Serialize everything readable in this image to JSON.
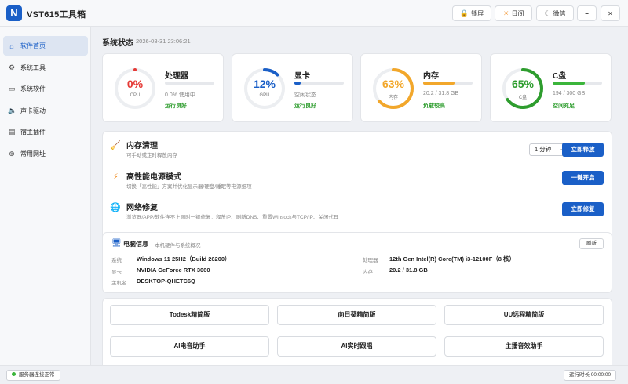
{
  "app": {
    "logo": "N",
    "title": "VST615工具箱"
  },
  "titlebar": {
    "buttons": [
      {
        "icon": "lock-icon",
        "label": "锁屏"
      },
      {
        "icon": "sun-icon",
        "label": "日间"
      },
      {
        "icon": "wechat-icon",
        "label": "微信"
      }
    ],
    "minimize": "−",
    "close": "✕"
  },
  "sidebar": {
    "items": [
      {
        "icon": "home-icon",
        "label": "软件首页",
        "active": true
      },
      {
        "icon": "gear-icon",
        "label": "系统工具"
      },
      {
        "icon": "folder-icon",
        "label": "系统软件"
      },
      {
        "icon": "speaker-icon",
        "label": "声卡驱动"
      },
      {
        "icon": "document-icon",
        "label": "宿主插件"
      },
      {
        "icon": "globe-icon",
        "label": "常用网址"
      }
    ]
  },
  "status": {
    "title": "系统状态",
    "time": "2026-08-31 23:06:21",
    "cards": [
      {
        "name": "处理器",
        "value": "0%",
        "unit": "CPU",
        "percent": 0,
        "detail": "0.0% 使用中",
        "state": "运行良好",
        "color": "#e53935",
        "bar_color": "#e53935",
        "state_color": "#2e9d2e"
      },
      {
        "name": "显卡",
        "value": "12%",
        "unit": "GPU",
        "percent": 12,
        "detail": "空闲状态",
        "state": "运行良好",
        "color": "#1a5fc7",
        "bar_color": "#1a5fc7",
        "state_color": "#2e9d2e"
      },
      {
        "name": "内存",
        "value": "63%",
        "unit": "内存",
        "percent": 63,
        "detail": "20.2 / 31.8 GB",
        "state": "负载较高",
        "color": "#f2a72b",
        "bar_color": "#f2a72b",
        "state_color": "#2e9d2e"
      },
      {
        "name": "C盘",
        "value": "65%",
        "unit": "C盘",
        "percent": 65,
        "detail": "194 / 300 GB",
        "state": "空间充足",
        "color": "#2e9d2e",
        "bar_color": "#3bb53b",
        "state_color": "#2e9d2e"
      }
    ]
  },
  "tools": [
    {
      "icon": "broom-icon",
      "title": "内存清理",
      "desc": "可手动或定时释放内存",
      "button": "立即释放",
      "select": "1 分钟"
    },
    {
      "icon": "lightning-icon",
      "title": "高性能电源模式",
      "desc": "切换「高性能」方案并优化显示器/硬盘/睡眠等电源细项",
      "button": "一键开启"
    },
    {
      "icon": "globe-icon",
      "title": "网络修复",
      "desc": "浏览器/APP/软件连不上网时一键修复：释放IP、刷新DNS、重置Winsock与TCP/IP、关闭代理",
      "button": "立即修复"
    }
  ],
  "info": {
    "title": "电脑信息",
    "subtitle": "本机硬件与系统概况",
    "refresh": "刷新",
    "left": [
      {
        "label": "系统",
        "value": "Windows 11 25H2（Build 26200）"
      },
      {
        "label": "显卡",
        "value": "NVIDIA GeForce RTX 3060"
      },
      {
        "label": "主机名",
        "value": "DESKTOP-QHETC6Q"
      }
    ],
    "right": [
      {
        "label": "处理器",
        "value": "12th Gen Intel(R) Core(TM) i3-12100F（8 核）"
      },
      {
        "label": "内存",
        "value": "20.2 / 31.8 GB"
      }
    ]
  },
  "shortcuts": [
    "Todesk精简版",
    "向日葵精简版",
    "UU远程精简版",
    "AI电音助手",
    "AI实时跟唱",
    "主播音效助手"
  ],
  "footer": {
    "server": "服务器连接正常",
    "uptime": "运行时长 00:00:00"
  }
}
